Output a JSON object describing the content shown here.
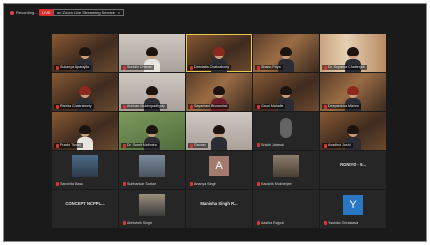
{
  "topbar": {
    "recording_label": "Recording...",
    "live_badge": "LIVE",
    "live_on": "on Zoom Live Streaming Service",
    "close_glyph": "x"
  },
  "tiles": [
    {
      "name": "Sukanya Aparajita",
      "style": "gold",
      "person": "dark"
    },
    {
      "name": "Sunidhi Dhiman",
      "style": "light",
      "person": "white"
    },
    {
      "name": "Debdatta Chakraborty",
      "style": "gold",
      "person": "red",
      "active": true
    },
    {
      "name": "Shanu Priya",
      "style": "gold2",
      "person": "dark"
    },
    {
      "name": "Dr. Suparna Chatterjee",
      "style": "curtain",
      "person": "dark"
    },
    {
      "name": "Rishita Chakraborty",
      "style": "gold",
      "person": "red"
    },
    {
      "name": "Anirban Mukhopadhyay",
      "style": "light",
      "person": "dark"
    },
    {
      "name": "Sayantani Bhowmick",
      "style": "gold2",
      "person": "maroon"
    },
    {
      "name": "Gauri Mahalle",
      "style": "gold",
      "person": "dark"
    },
    {
      "name": "Deepshikha Mishra",
      "style": "gold2",
      "person": "red"
    },
    {
      "name": "Prachi Tiwari",
      "style": "gold",
      "person": "white"
    },
    {
      "name": "Dr. Sumit Malhotra",
      "style": "green",
      "person": "dark"
    },
    {
      "name": "Gaurav",
      "style": "light",
      "person": "dark"
    },
    {
      "name": "Srishti Jaiswal",
      "style": "dark",
      "blur": true
    },
    {
      "name": "Avadhut Joshi",
      "style": "gold",
      "person": "dark"
    },
    {
      "name": "Sanchita Basu",
      "style": "dark",
      "thumb": "photo1"
    },
    {
      "name": "Subhankar Sarkar",
      "style": "dark",
      "thumb": "photo2"
    },
    {
      "name": "Ananya Singh",
      "style": "dark",
      "letter": "A"
    },
    {
      "name": "Kaushik Mukherjee",
      "style": "dark",
      "thumb": "photo3"
    },
    {
      "name": "",
      "style": "dark",
      "text": "RGNIYD - 9..."
    },
    {
      "name": "",
      "style": "dark",
      "text": "CONCEPT NCPPL..."
    },
    {
      "name": "Abhishek Singh",
      "style": "dark",
      "thumb": "photo4"
    },
    {
      "name": "",
      "style": "dark",
      "text": "Manisha Singh R..."
    },
    {
      "name": "Aastha Rajput",
      "style": "dark"
    },
    {
      "name": "Yashika Srivastava",
      "style": "dark",
      "letter": "Y"
    }
  ]
}
